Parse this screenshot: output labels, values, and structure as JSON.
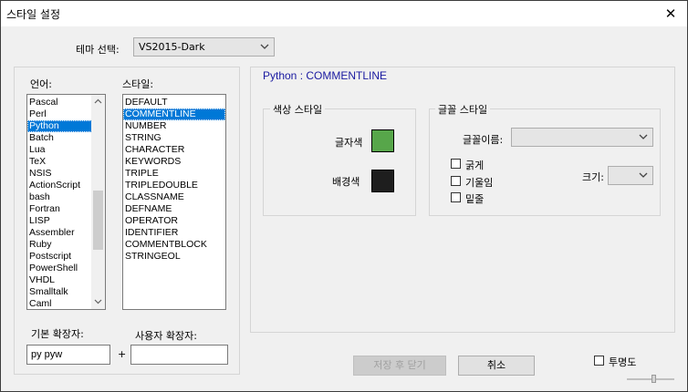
{
  "window": {
    "title": "스타일 설정",
    "close_glyph": "✕"
  },
  "theme": {
    "label": "테마 선택:",
    "value": "VS2015-Dark"
  },
  "language": {
    "label": "언어:",
    "items": [
      "Pascal",
      "Perl",
      "Python",
      "Batch",
      "Lua",
      "TeX",
      "NSIS",
      "ActionScript",
      "bash",
      "Fortran",
      "LISP",
      "Assembler",
      "Ruby",
      "Postscript",
      "PowerShell",
      "VHDL",
      "Smalltalk",
      "Caml"
    ],
    "selected": "Python"
  },
  "style_list": {
    "label": "스타일:",
    "items": [
      "DEFAULT",
      "COMMENTLINE",
      "NUMBER",
      "STRING",
      "CHARACTER",
      "KEYWORDS",
      "TRIPLE",
      "TRIPLEDOUBLE",
      "CLASSNAME",
      "DEFNAME",
      "OPERATOR",
      "IDENTIFIER",
      "COMMENTBLOCK",
      "STRINGEOL"
    ],
    "selected": "COMMENTLINE"
  },
  "default_ext": {
    "label": "기본 확장자:",
    "value": "py pyw"
  },
  "plus_sign": "+",
  "user_ext": {
    "label": "사용자 확장자:",
    "value": ""
  },
  "panel": {
    "title": "Python : COMMENTLINE",
    "color_group": {
      "caption": "색상 스타일",
      "fg_label": "글자색",
      "fg_color": "#57a64a",
      "bg_label": "배경색",
      "bg_color": "#1e1e1e"
    },
    "font_group": {
      "caption": "글꼴 스타일",
      "name_label": "글꼴이름:",
      "name_value": "",
      "bold_label": "굵게",
      "italic_label": "기울임",
      "underline_label": "밑줄",
      "size_label": "크기:",
      "size_value": ""
    }
  },
  "buttons": {
    "save_close": "저장 후 닫기",
    "cancel": "취소"
  },
  "transparency": {
    "label": "투명도"
  },
  "icons": {
    "dropdown": "chevron-down-icon",
    "close": "close-icon"
  }
}
